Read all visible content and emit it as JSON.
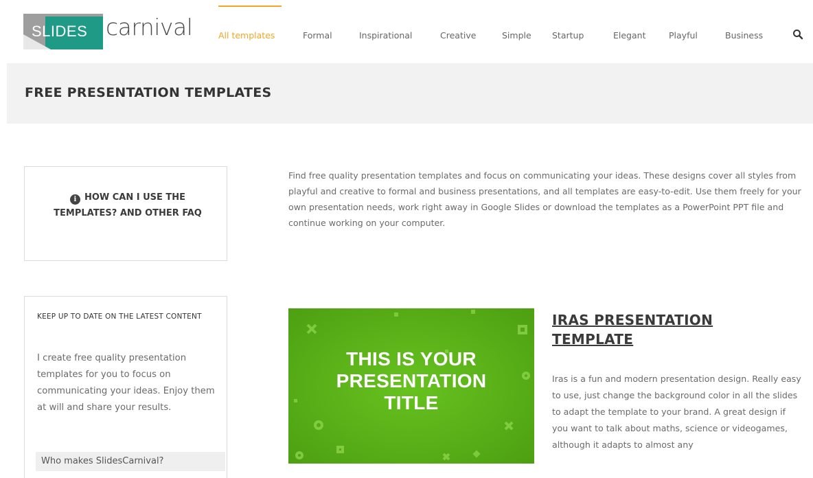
{
  "header": {
    "logo": {
      "slides": "SLIDES",
      "carnival": "carnival"
    },
    "nav": [
      {
        "label": "All templates",
        "active": true
      },
      {
        "label": "Formal",
        "active": false
      },
      {
        "label": "Inspirational",
        "active": false
      },
      {
        "label": "Creative",
        "active": false
      },
      {
        "label": "Simple",
        "active": false
      },
      {
        "label": "Startup",
        "active": false
      },
      {
        "label": "Elegant",
        "active": false
      },
      {
        "label": "Playful",
        "active": false
      },
      {
        "label": "Business",
        "active": false
      }
    ],
    "search_icon": "search-icon",
    "accent_color": "#f5a623"
  },
  "page": {
    "title": "FREE PRESENTATION TEMPLATES"
  },
  "faq": {
    "icon": "info-icon",
    "label": "HOW CAN I USE THE TEMPLATES? AND OTHER FAQ"
  },
  "intro": {
    "text": "Find free quality presentation templates and focus on communicating your ideas. These designs cover all styles from playful and creative to formal and business presentations, and all templates are easy-to-edit. Use them freely for your own presentation needs, work right away in Google Slides or download the templates as a PowerPoint PPT file and continue working on your computer."
  },
  "newsletter": {
    "heading": "KEEP UP TO DATE ON THE LATEST CONTENT",
    "body": "I create free quality presentation templates for you to focus on communicating your ideas. Enjoy them at will and share your results.",
    "who_label": "Who makes SlidesCarnival?"
  },
  "template": {
    "thumb_title_line1": "THIS IS YOUR",
    "thumb_title_line2": "PRESENTATION",
    "thumb_title_line3": "TITLE",
    "thumb_color": "#5ab317",
    "title": "IRAS PRESENTATION TEMPLATE",
    "description": "Iras is a fun and modern presentation design. Really easy to use, just change the background color in all the slides to adapt the template to your brand. A great design if you want to talk about maths, science or videogames, although it adapts to almost any"
  }
}
